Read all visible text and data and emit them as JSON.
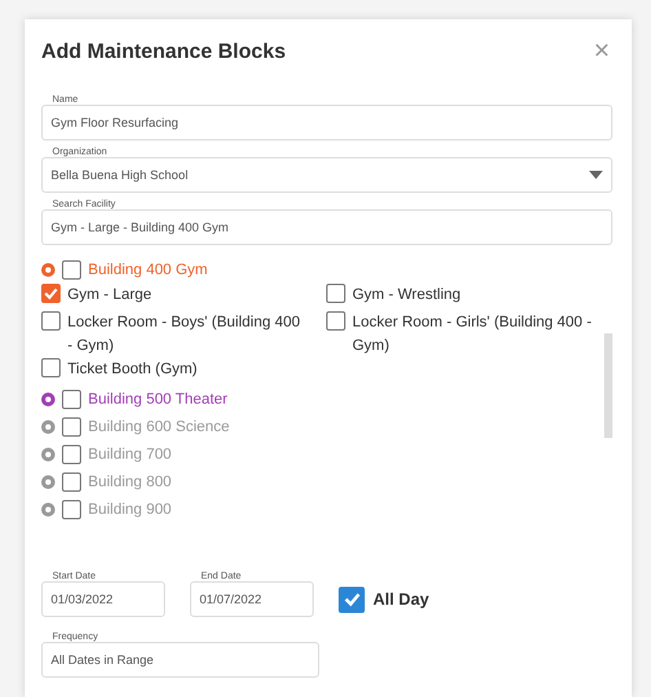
{
  "dialog": {
    "title": "Add Maintenance Blocks",
    "close": "×"
  },
  "fields": [
    {
      "label": "Name",
      "value": "Gym Floor Resurfacing",
      "kind": "text"
    },
    {
      "label": "Organization",
      "value": "Bella Buena High School",
      "kind": "select"
    },
    {
      "label": "Search Facility",
      "value": "Gym - Large - Building 400 Gym",
      "kind": "text"
    }
  ],
  "facility_groups": [
    {
      "label": "Building 400 Gym",
      "color": "#f0622c",
      "checked": false,
      "items": [
        {
          "label": "Gym - Large",
          "checked": true
        },
        {
          "label": "Gym - Wrestling",
          "checked": false
        },
        {
          "label": "Locker Room - Boys' (Building 400 - Gym)",
          "checked": false
        },
        {
          "label": "Locker Room - Girls' (Building 400 - Gym)",
          "checked": false
        },
        {
          "label": "Ticket Booth (Gym)",
          "checked": false
        }
      ]
    },
    {
      "label": "Building 500 Theater",
      "color": "#a13fb5",
      "checked": false
    },
    {
      "label": "Building 600 Science",
      "color": "#9a9a9a",
      "checked": false
    },
    {
      "label": "Building 700",
      "color": "#9a9a9a",
      "checked": false
    },
    {
      "label": "Building 800",
      "color": "#9a9a9a",
      "checked": false
    },
    {
      "label": "Building 900",
      "color": "#9a9a9a",
      "checked": false
    }
  ],
  "dates": [
    {
      "label": "Start Date",
      "value": "01/03/2022"
    },
    {
      "label": "End Date",
      "value": "01/07/2022"
    }
  ],
  "all_day": {
    "label": "All Day",
    "checked": true
  },
  "frequency": {
    "label": "Frequency",
    "value": "All Dates in Range"
  }
}
